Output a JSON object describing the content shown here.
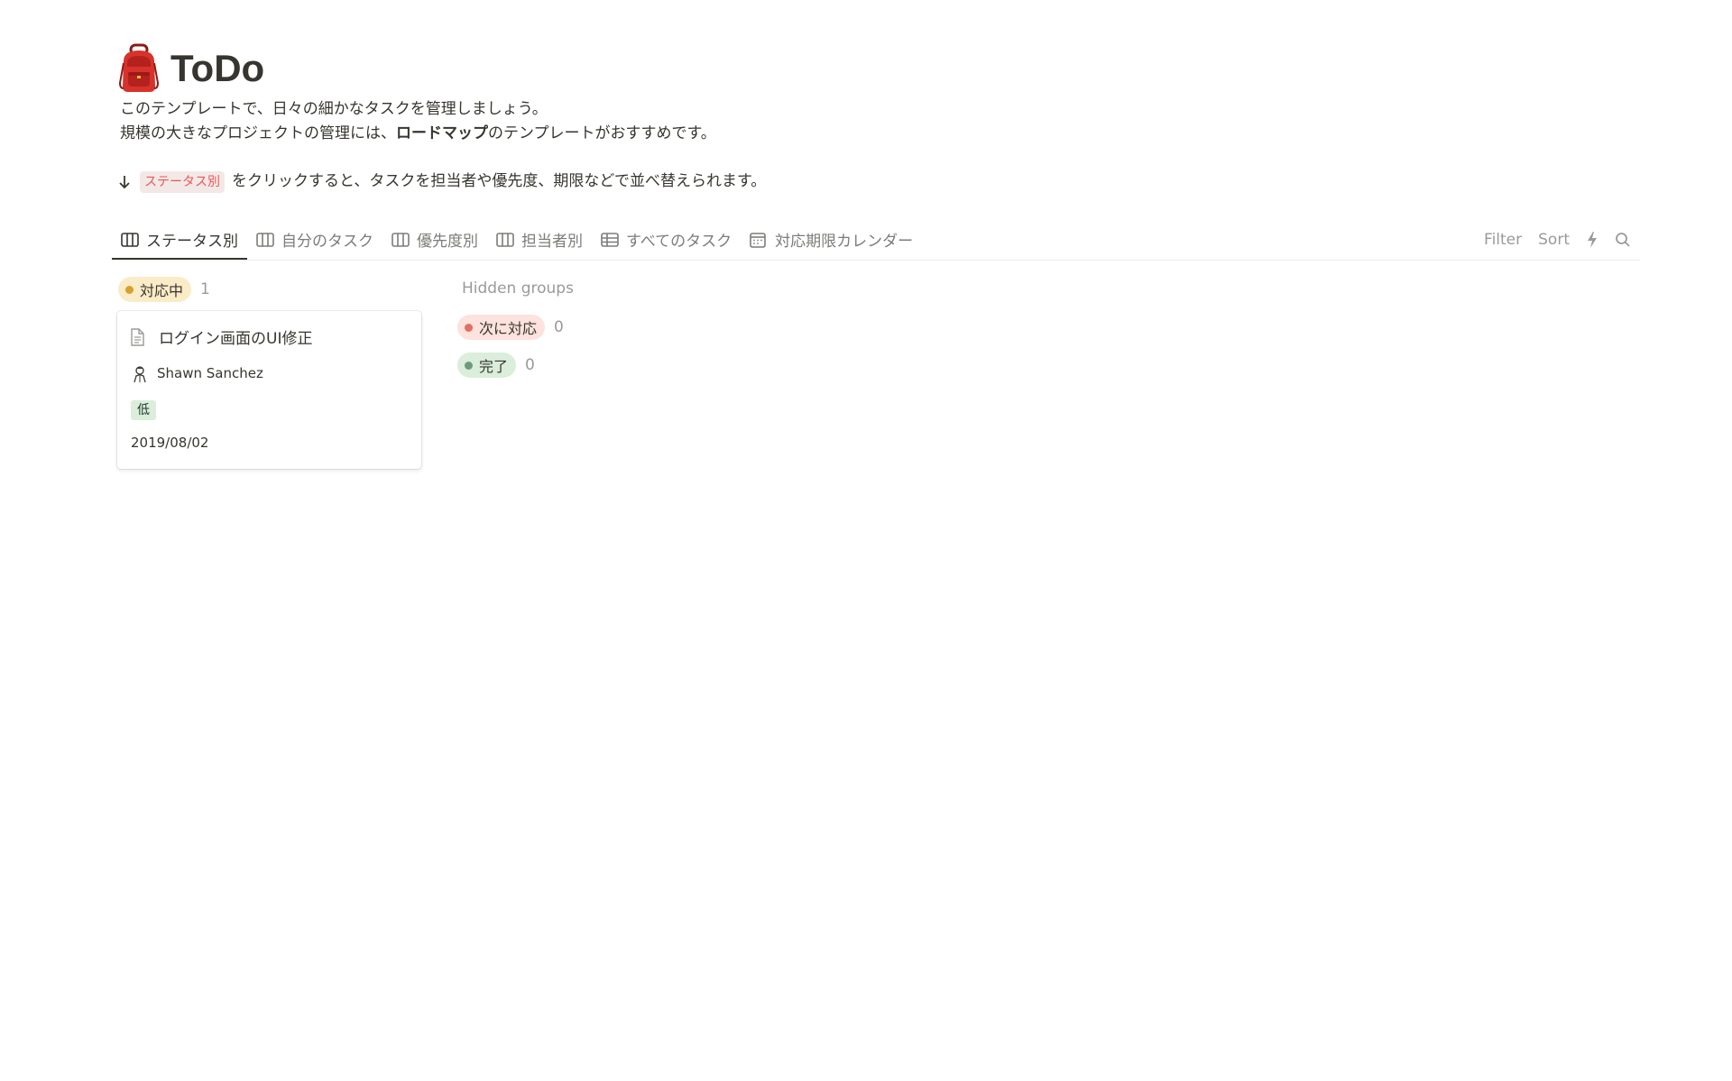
{
  "page": {
    "title": "ToDo",
    "icon": "backpack-icon"
  },
  "description": {
    "line1": "このテンプレートで、日々の細かなタスクを管理しましょう。",
    "line2_before": "規模の大きなプロジェクトの管理には、",
    "line2_bold": "ロードマップ",
    "line2_after": "のテンプレートがおすすめです。",
    "hint_tag": "ステータス別",
    "hint_text": "をクリックすると、タスクを担当者や優先度、期限などで並べ替えられます。"
  },
  "tabs": [
    {
      "label": "ステータス別",
      "icon": "board-icon",
      "active": true
    },
    {
      "label": "自分のタスク",
      "icon": "board-icon",
      "active": false
    },
    {
      "label": "優先度別",
      "icon": "board-icon",
      "active": false
    },
    {
      "label": "担当者別",
      "icon": "board-icon",
      "active": false
    },
    {
      "label": "すべてのタスク",
      "icon": "table-icon",
      "active": false
    },
    {
      "label": "対応期限カレンダー",
      "icon": "calendar-icon",
      "active": false
    }
  ],
  "toolbar": {
    "filter_label": "Filter",
    "sort_label": "Sort",
    "automation_icon": "lightning-icon",
    "search_icon": "search-icon"
  },
  "board": {
    "groups": [
      {
        "label": "対応中",
        "count": "1",
        "color": "#fbecc8",
        "dot_color": "#d9a02e",
        "cards": [
          {
            "title": "ログイン画面のUI修正",
            "assignee": "Shawn Sanchez",
            "priority": "低",
            "date": "2019/08/02"
          }
        ]
      }
    ],
    "hidden_groups_title": "Hidden groups",
    "hidden_groups": [
      {
        "label": "次に対応",
        "count": "0",
        "color": "#fde2dd",
        "dot_color": "#e16f64"
      },
      {
        "label": "完了",
        "count": "0",
        "color": "#dbeddb",
        "dot_color": "#6c9b7d"
      }
    ]
  }
}
